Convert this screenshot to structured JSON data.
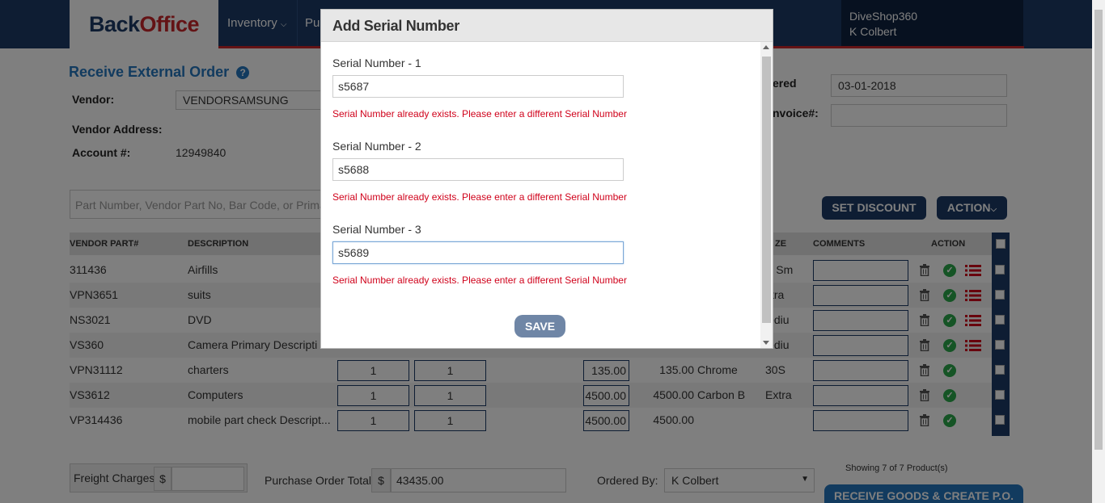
{
  "header": {
    "logo_part1": "Back",
    "logo_part2": "Office",
    "nav": [
      {
        "label": "Inventory"
      },
      {
        "label": "Pu"
      }
    ],
    "user": {
      "shop": "DiveShop360",
      "name": "K Colbert"
    }
  },
  "page": {
    "title": "Receive External Order",
    "vendor_label": "Vendor:",
    "vendor_value": "VENDORSAMSUNG",
    "vendor_address_label": "Vendor Address:",
    "account_label": "Account #:",
    "account_value": "12949840",
    "ordered_label": "ered",
    "ordered_value": "03-01-2018",
    "invoice_label": "nvoice#:",
    "search_placeholder": "Part Number, Vendor Part No, Bar Code, or Prima",
    "set_discount_label": "SET DISCOUNT",
    "action_label": "ACTION",
    "columns": {
      "vendor_part": "VENDOR PART#",
      "description": "DESCRIPTION",
      "size": "ZE",
      "comments": "COMMENTS",
      "action": "ACTION"
    },
    "rows": [
      {
        "part": "311436",
        "desc": "Airfills",
        "qty1": "",
        "qty2": "",
        "cost": "",
        "ext": "",
        "color": "",
        "size": "X Sm"
      },
      {
        "part": "VPN3651",
        "desc": "suits",
        "qty1": "",
        "qty2": "",
        "cost": "",
        "ext": "",
        "color": "",
        "size": "xtra"
      },
      {
        "part": "NS3021",
        "desc": "DVD",
        "qty1": "",
        "qty2": "",
        "cost": "",
        "ext": "",
        "color": "",
        "size": "lediu"
      },
      {
        "part": "VS360",
        "desc": "Camera Primary Descripti",
        "qty1": "",
        "qty2": "",
        "cost": "",
        "ext": "",
        "color": "",
        "size": "lediu"
      },
      {
        "part": "VPN31112",
        "desc": "charters",
        "qty1": "1",
        "qty2": "1",
        "cost": "135.00",
        "ext": "135.00",
        "color": "Chrome",
        "size": "30S"
      },
      {
        "part": "VS3612",
        "desc": "Computers",
        "qty1": "1",
        "qty2": "1",
        "cost": "4500.00",
        "ext": "4500.00",
        "color": "Carbon B",
        "size": "Extra"
      },
      {
        "part": "VP314436",
        "desc": "mobile part check Descript...",
        "qty1": "1",
        "qty2": "1",
        "cost": "4500.00",
        "ext": "4500.00",
        "color": "",
        "size": ""
      }
    ],
    "footer": {
      "freight_label": "Freight Charges",
      "currency": "$",
      "po_total_label": "Purchase Order Total",
      "po_total_value": "43435.00",
      "ordered_by_label": "Ordered By:",
      "ordered_by_value": "K Colbert",
      "showing": "Showing 7 of 7 Product(s)",
      "receive_button": "RECEIVE GOODS & CREATE P.O."
    }
  },
  "modal": {
    "title": "Add Serial Number",
    "fields": [
      {
        "label": "Serial Number - 1",
        "value": "s5687",
        "error": "Serial Number already exists. Please enter a different Serial Number"
      },
      {
        "label": "Serial Number - 2",
        "value": "s5688",
        "error": "Serial Number already exists. Please enter a different Serial Number"
      },
      {
        "label": "Serial Number - 3",
        "value": "s5689",
        "error": "Serial Number already exists. Please enter a different Serial Number"
      }
    ],
    "save_label": "SAVE"
  },
  "colors": {
    "brand_navy": "#1c3b66",
    "brand_red": "#c8262b",
    "link_blue": "#2476bf",
    "error_red": "#d0021b",
    "save_button": "#6f86a6"
  }
}
